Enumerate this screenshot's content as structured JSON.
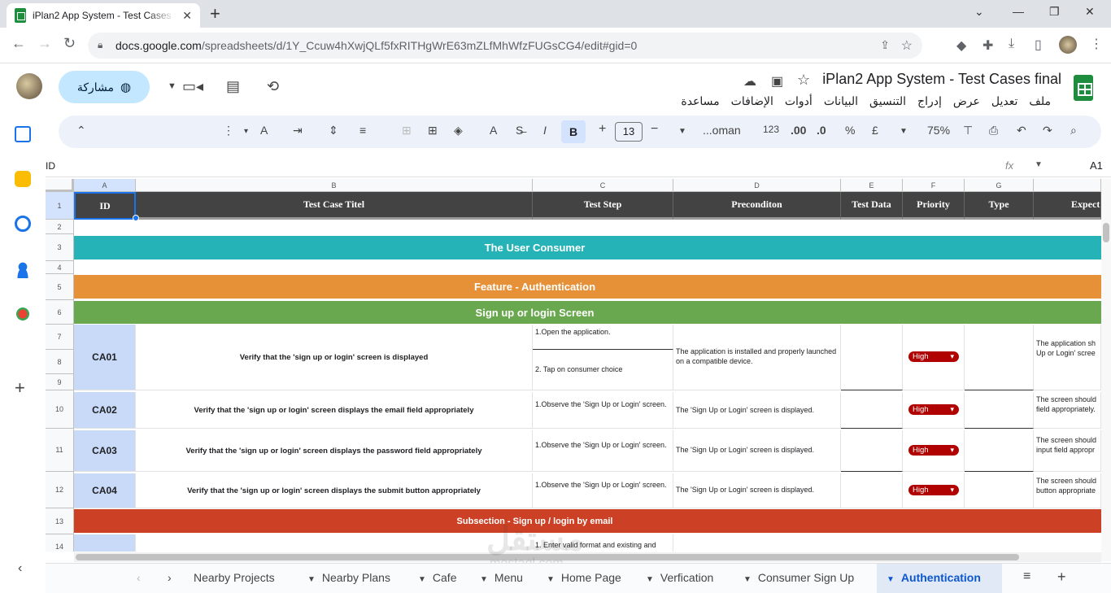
{
  "browser": {
    "tab_title": "iPlan2 App System - Test Cases f",
    "url_host": "docs.google.com",
    "url_path": "/spreadsheets/d/1Y_Ccuw4hXwjQLf5fxRITHgWrE63mZLfMhWfzFUGsCG4/edit#gid=0"
  },
  "app": {
    "share_label": "مشاركة",
    "doc_title": "iPlan2 App System - Test Cases final",
    "menus": [
      "ملف",
      "تعديل",
      "عرض",
      "إدراج",
      "التنسيق",
      "البيانات",
      "أدوات",
      "الإضافات",
      "مساعدة"
    ]
  },
  "toolbar": {
    "zoom": "75%",
    "font_name": "...oman",
    "font_size": "13",
    "currency": "£",
    "percent": "%",
    "dec_less": ".0",
    "dec_more": ".00",
    "num_format": "123",
    "bold": "B",
    "italic": "I"
  },
  "formula_bar": {
    "cell_ref": "A1",
    "content": "ID",
    "fx": "fx"
  },
  "grid": {
    "col_letters": [
      "A",
      "B",
      "C",
      "D",
      "E",
      "F",
      "G"
    ],
    "row_numbers": [
      "1",
      "2",
      "3",
      "4",
      "5",
      "6",
      "7",
      "8",
      "9",
      "10",
      "11",
      "12",
      "13",
      "14"
    ],
    "headers": [
      "ID",
      "Test Case Titel",
      "Test Step",
      "Preconditon",
      "Test Data",
      "Priority",
      "Type",
      "Expect"
    ],
    "band_user": "The User Consumer",
    "band_feature": "Feature -  Authentication",
    "band_screen": "Sign up or login  Screen",
    "band_subsection": "Subsection -   Sign up / login by email",
    "rows": [
      {
        "id": "CA01",
        "title": "Verify that the 'sign up or login' screen is displayed",
        "step1": "1.Open the application.",
        "step2": "2. Tap on consumer choice",
        "pre": "The application is installed and properly launched on a compatible device.",
        "priority": "High",
        "expect": "The application sh Up or Login' scree"
      },
      {
        "id": "CA02",
        "title": "Verify that the 'sign up or login' screen displays the email field appropriately",
        "step1": "1.Observe the 'Sign Up or Login' screen.",
        "pre": "The 'Sign Up or Login' screen is displayed.",
        "priority": "High",
        "expect": "The screen should field appropriately."
      },
      {
        "id": "CA03",
        "title": "Verify that the 'sign up or login' screen displays the password field appropriately",
        "step1": "1.Observe the 'Sign Up or Login' screen.",
        "pre": "The 'Sign Up or Login' screen is displayed.",
        "priority": "High",
        "expect": "The screen should input field appropr"
      },
      {
        "id": "CA04",
        "title": "Verify that the 'sign up or login' screen displays the submit button appropriately",
        "step1": "1.Observe the 'Sign Up or Login' screen.",
        "pre": "The 'Sign Up or Login' screen is displayed.",
        "priority": "High",
        "expect": "The screen should button appropriate"
      }
    ],
    "row14_step": "1. Enter valid format and existing and"
  },
  "sheet_tabs": [
    "Nearby Projects",
    "Nearby Plans",
    "Cafe",
    "Menu",
    "Home Page",
    "Verfication",
    "Consumer Sign Up",
    "Authentication"
  ],
  "watermark": {
    "big": "مستقل",
    "small": "mostaql.com"
  },
  "colors": {
    "header_bg": "#434343",
    "band_user": "#26b3b8",
    "band_feature": "#e69138",
    "band_screen": "#6aa84f",
    "band_subsection": "#cc4125",
    "id_bg": "#c9daf8",
    "chip": "#b10202"
  }
}
